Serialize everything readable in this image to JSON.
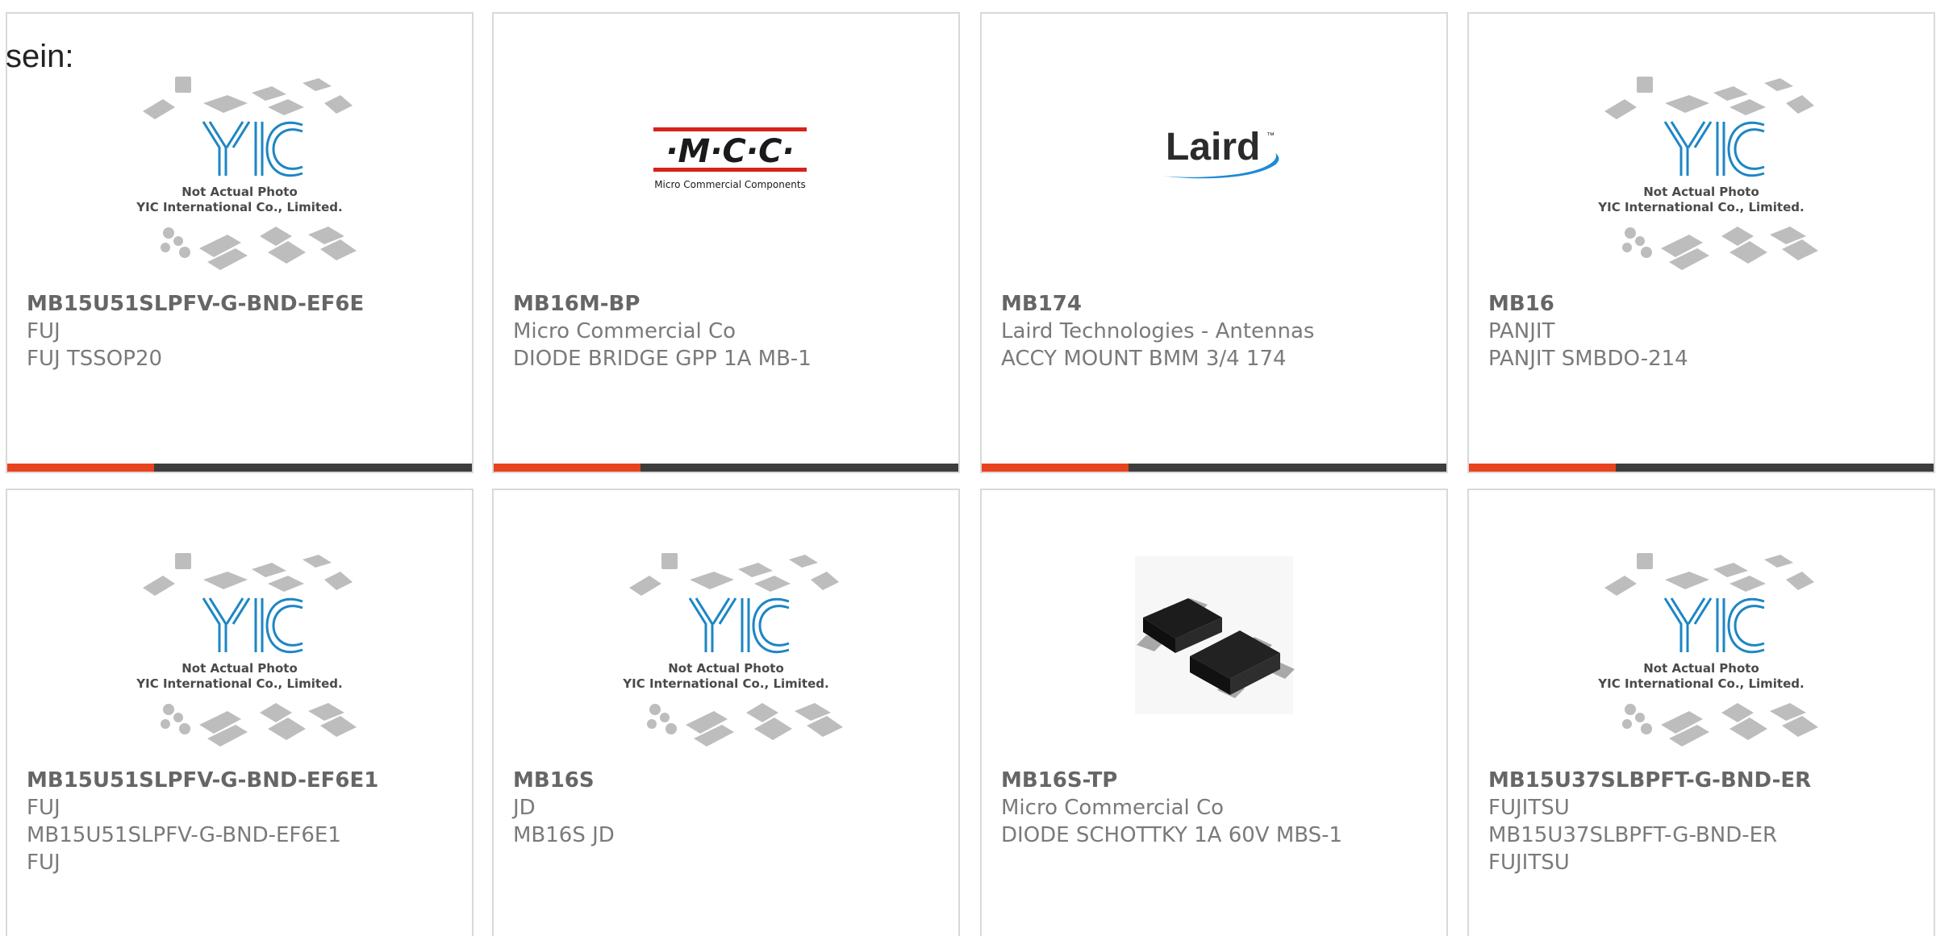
{
  "intro_text": "sein:",
  "colors": {
    "card_border": "#d9d9d9",
    "text_gray": "#6b6b6b",
    "accent_orange": "#e8421f",
    "bar_dark": "#3d3d3d",
    "yic_blue": "#1d86c4",
    "mcc_red": "#d6231c",
    "laird_blue": "#1e8bd4"
  },
  "placeholder_caption": {
    "line1": "Not Actual Photo",
    "line2": "YIC International Co., Limited."
  },
  "logos": {
    "mcc": {
      "name": "·M·C·C·",
      "tagline": "Micro Commercial Components"
    },
    "laird": {
      "name": "Laird",
      "tm": "™"
    },
    "yic": {
      "name": "YIC"
    }
  },
  "products": [
    {
      "image": "yic-placeholder",
      "part_number": "MB15U51SLPFV-G-BND-EF6E",
      "manufacturer": "FUJ",
      "description": "FUJ TSSOP20",
      "extra": ""
    },
    {
      "image": "mcc-logo",
      "part_number": "MB16M-BP",
      "manufacturer": "Micro Commercial Co",
      "description": "DIODE BRIDGE GPP 1A MB-1",
      "extra": ""
    },
    {
      "image": "laird-logo",
      "part_number": "MB174",
      "manufacturer": "Laird Technologies - Antennas",
      "description": "ACCY MOUNT BMM 3/4 174",
      "extra": ""
    },
    {
      "image": "yic-placeholder",
      "part_number": "MB16",
      "manufacturer": "PANJIT",
      "description": "PANJIT SMBDO-214",
      "extra": ""
    },
    {
      "image": "yic-placeholder",
      "part_number": "MB15U51SLPFV-G-BND-EF6E1",
      "manufacturer": "FUJ",
      "description": "MB15U51SLPFV-G-BND-EF6E1",
      "extra": "FUJ"
    },
    {
      "image": "yic-placeholder",
      "part_number": "MB16S",
      "manufacturer": "JD",
      "description": "MB16S JD",
      "extra": ""
    },
    {
      "image": "chip-photo",
      "part_number": "MB16S-TP",
      "manufacturer": "Micro Commercial Co",
      "description": "DIODE SCHOTTKY 1A 60V MBS-1",
      "extra": ""
    },
    {
      "image": "yic-placeholder",
      "part_number": "MB15U37SLBPFT-G-BND-ER",
      "manufacturer": "FUJITSU",
      "description": "MB15U37SLBPFT-G-BND-ER",
      "extra": "FUJITSU"
    }
  ]
}
